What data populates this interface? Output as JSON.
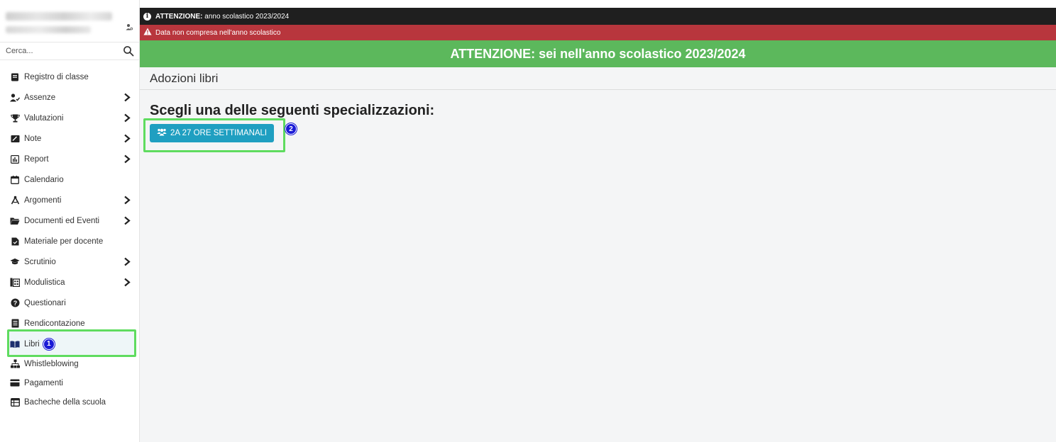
{
  "sidebar": {
    "search_placeholder": "Cerca...",
    "items": [
      {
        "label": "Registro di classe",
        "icon": "book-icon",
        "has_submenu": false
      },
      {
        "label": "Assenze",
        "icon": "user-check-icon",
        "has_submenu": true
      },
      {
        "label": "Valutazioni",
        "icon": "trophy-icon",
        "has_submenu": true
      },
      {
        "label": "Note",
        "icon": "note-icon",
        "has_submenu": true
      },
      {
        "label": "Report",
        "icon": "chart-icon",
        "has_submenu": true
      },
      {
        "label": "Calendario",
        "icon": "calendar-icon",
        "has_submenu": false
      },
      {
        "label": "Argomenti",
        "icon": "compass-icon",
        "has_submenu": true
      },
      {
        "label": "Documenti ed Eventi",
        "icon": "folder-icon",
        "has_submenu": true
      },
      {
        "label": "Materiale per docente",
        "icon": "file-icon",
        "has_submenu": false
      },
      {
        "label": "Scrutinio",
        "icon": "graduation-cap-icon",
        "has_submenu": true
      },
      {
        "label": "Modulistica",
        "icon": "forms-icon",
        "has_submenu": true
      },
      {
        "label": "Questionari",
        "icon": "question-circle-icon",
        "has_submenu": false
      },
      {
        "label": "Rendicontazione",
        "icon": "list-icon",
        "has_submenu": false
      },
      {
        "label": "Libri",
        "icon": "open-book-icon",
        "has_submenu": false,
        "marker": "1"
      },
      {
        "label": "Whistleblowing",
        "icon": "network-icon",
        "has_submenu": false
      },
      {
        "label": "Pagamenti",
        "icon": "credit-card-icon",
        "has_submenu": false
      },
      {
        "label": "Bacheche della scuola",
        "icon": "table-icon",
        "has_submenu": false
      }
    ]
  },
  "alerts": {
    "year_prefix": "ATTENZIONE:",
    "year_text": " anno scolastico 2023/2024",
    "date_warning": "Data non compresa nell'anno scolastico"
  },
  "banner": {
    "text": "ATTENZIONE: sei nell'anno scolastico 2023/2024"
  },
  "main": {
    "title": "Adozioni libri",
    "heading": "Scegli una delle seguenti specializzazioni:",
    "specialization_button": "2A 27 ORE SETTIMANALI",
    "marker": "2"
  },
  "colors": {
    "banner_green": "#5cb85c",
    "alert_red": "#b8363d",
    "alert_dark": "#1f1f1f",
    "button_blue": "#1f9fc1",
    "highlight_green": "#5fdc5f",
    "marker_blue": "#1a1ad6"
  }
}
